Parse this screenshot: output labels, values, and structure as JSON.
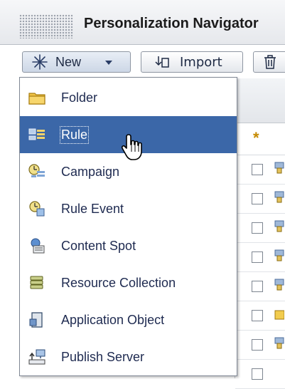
{
  "window": {
    "title": "Personalization Navigator"
  },
  "toolbar": {
    "new_label": "New",
    "import_label": "Import",
    "delete_icon": "trash-icon"
  },
  "menu": {
    "items": [
      {
        "label": "Folder",
        "icon": "folder-icon"
      },
      {
        "label": "Rule",
        "icon": "rule-icon",
        "selected": true
      },
      {
        "label": "Campaign",
        "icon": "campaign-icon"
      },
      {
        "label": "Rule Event",
        "icon": "rule-event-icon"
      },
      {
        "label": "Content Spot",
        "icon": "content-spot-icon"
      },
      {
        "label": "Resource Collection",
        "icon": "resource-collection-icon"
      },
      {
        "label": "Application Object",
        "icon": "application-object-icon"
      },
      {
        "label": "Publish Server",
        "icon": "publish-server-icon"
      }
    ]
  },
  "table": {
    "new_row_marker": "*"
  },
  "colors": {
    "selection": "#3b67a8",
    "menu_text": "#1e2a50",
    "folder": "#e8b52b"
  }
}
